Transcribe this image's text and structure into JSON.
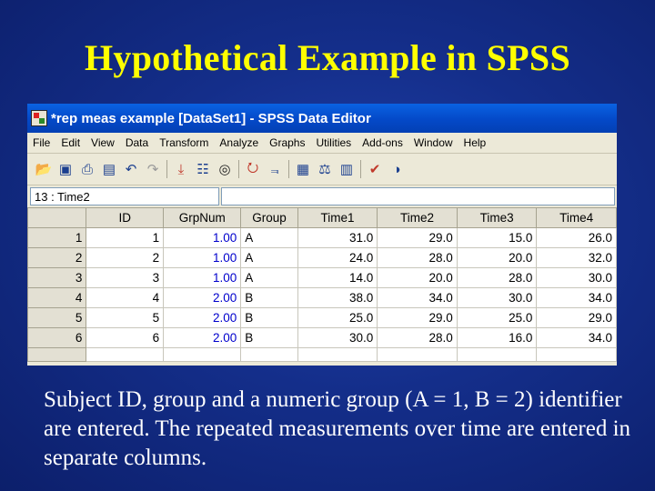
{
  "slide": {
    "title": "Hypothetical Example in SPSS",
    "caption": "Subject ID, group and a numeric group (A = 1, B = 2) identifier are entered.  The repeated measurements over time are entered in separate columns."
  },
  "window": {
    "title": "*rep meas example [DataSet1] - SPSS Data Editor"
  },
  "menu": [
    "File",
    "Edit",
    "View",
    "Data",
    "Transform",
    "Analyze",
    "Graphs",
    "Utilities",
    "Add-ons",
    "Window",
    "Help"
  ],
  "toolbar_icons": [
    "open-icon",
    "save-icon",
    "print-icon",
    "dialog-recall-icon",
    "undo-icon",
    "redo-icon",
    "goto-case-icon",
    "variables-icon",
    "find-icon",
    "insert-cases-icon",
    "insert-variable-icon",
    "split-file-icon",
    "weight-cases-icon",
    "select-cases-icon",
    "value-labels-icon",
    "use-sets-icon"
  ],
  "cell_editor": {
    "ref": "13 : Time2",
    "value": ""
  },
  "grid": {
    "columns": [
      "ID",
      "GrpNum",
      "Group",
      "Time1",
      "Time2",
      "Time3",
      "Time4"
    ],
    "rows": [
      {
        "num": "1",
        "cells": [
          "1",
          "1.00",
          "A",
          "31.0",
          "29.0",
          "15.0",
          "26.0"
        ]
      },
      {
        "num": "2",
        "cells": [
          "2",
          "1.00",
          "A",
          "24.0",
          "28.0",
          "20.0",
          "32.0"
        ]
      },
      {
        "num": "3",
        "cells": [
          "3",
          "1.00",
          "A",
          "14.0",
          "20.0",
          "28.0",
          "30.0"
        ]
      },
      {
        "num": "4",
        "cells": [
          "4",
          "2.00",
          "B",
          "38.0",
          "34.0",
          "30.0",
          "34.0"
        ]
      },
      {
        "num": "5",
        "cells": [
          "5",
          "2.00",
          "B",
          "25.0",
          "29.0",
          "25.0",
          "29.0"
        ]
      },
      {
        "num": "6",
        "cells": [
          "6",
          "2.00",
          "B",
          "30.0",
          "28.0",
          "16.0",
          "34.0"
        ]
      }
    ]
  }
}
